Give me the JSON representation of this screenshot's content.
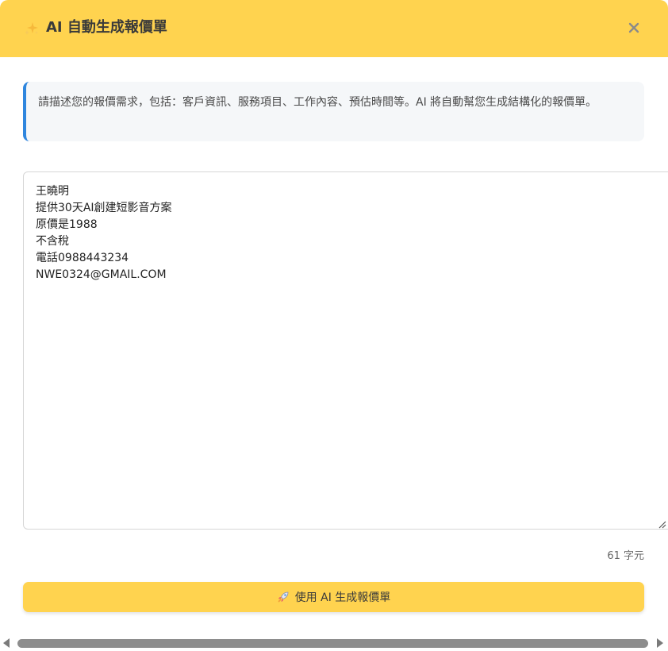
{
  "header": {
    "icon": "sparkles-icon",
    "title": "AI 自動生成報價單",
    "close_icon": "close-icon",
    "background_color": "#ffd34f"
  },
  "info": {
    "text": "請描述您的報價需求，包括：客戶資訊、服務項目、工作內容、預估時間等。AI 將自動幫您生成結構化的報價單。",
    "accent_color": "#2f86de"
  },
  "input": {
    "value": "王曉明\n提供30天AI創建短影音方案\n原價是1988\n不含稅\n電話0988443234\nNWE0324@GMAIL.COM",
    "char_count": "61 字元"
  },
  "generate_button": {
    "icon": "rocket-icon",
    "label": "使用 AI 生成報價單",
    "color": "#ffd34f"
  }
}
